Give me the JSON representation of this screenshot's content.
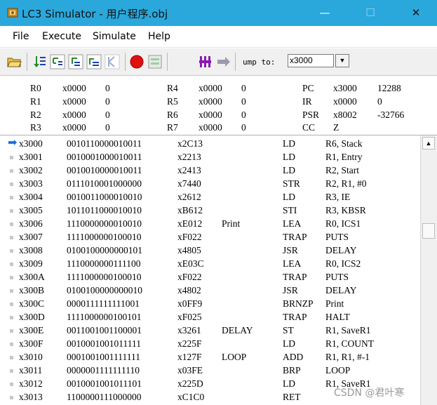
{
  "window": {
    "title": "LC3 Simulator - 用户程序.obj",
    "minimize": "—",
    "maximize": "☐",
    "close": "✕",
    "titlebar_color": "#2aa8dc"
  },
  "menu": {
    "file": "File",
    "execute": "Execute",
    "simulate": "Simulate",
    "help": "Help"
  },
  "toolbar": {
    "jump_label": "ump to:",
    "jump_value": "x3000",
    "jump_dropdown": "▼"
  },
  "registers": {
    "R0": {
      "name": "R0",
      "hex": "x0000",
      "dec": "0"
    },
    "R1": {
      "name": "R1",
      "hex": "x0000",
      "dec": "0"
    },
    "R2": {
      "name": "R2",
      "hex": "x0000",
      "dec": "0"
    },
    "R3": {
      "name": "R3",
      "hex": "x0000",
      "dec": "0"
    },
    "R4": {
      "name": "R4",
      "hex": "x0000",
      "dec": "0"
    },
    "R5": {
      "name": "R5",
      "hex": "x0000",
      "dec": "0"
    },
    "R6": {
      "name": "R6",
      "hex": "x0000",
      "dec": "0"
    },
    "R7": {
      "name": "R7",
      "hex": "x0000",
      "dec": "0"
    },
    "PC": {
      "name": "PC",
      "hex": "x3000",
      "dec": "12288"
    },
    "IR": {
      "name": "IR",
      "hex": "x0000",
      "dec": "0"
    },
    "PSR": {
      "name": "PSR",
      "hex": "x8002",
      "dec": "-32766"
    },
    "CC": {
      "name": "CC",
      "value": "Z"
    }
  },
  "code": [
    {
      "addr": "x3000",
      "bin": "0010110000010011",
      "hex": "x2C13",
      "label": "",
      "op": "LD",
      "args": "R6, Stack",
      "current": true
    },
    {
      "addr": "x3001",
      "bin": "0010001000010011",
      "hex": "x2213",
      "label": "",
      "op": "LD",
      "args": "R1, Entry"
    },
    {
      "addr": "x3002",
      "bin": "0010010000010011",
      "hex": "x2413",
      "label": "",
      "op": "LD",
      "args": "R2, Start"
    },
    {
      "addr": "x3003",
      "bin": "0111010001000000",
      "hex": "x7440",
      "label": "",
      "op": "STR",
      "args": "R2, R1, #0"
    },
    {
      "addr": "x3004",
      "bin": "0010011000010010",
      "hex": "x2612",
      "label": "",
      "op": "LD",
      "args": "R3, IE"
    },
    {
      "addr": "x3005",
      "bin": "1011011000010010",
      "hex": "xB612",
      "label": "",
      "op": "STI",
      "args": "R3, KBSR"
    },
    {
      "addr": "x3006",
      "bin": "1110000000010010",
      "hex": "xE012",
      "label": "Print",
      "op": "LEA",
      "args": "R0, ICS1"
    },
    {
      "addr": "x3007",
      "bin": "1111000000100010",
      "hex": "xF022",
      "label": "",
      "op": "TRAP",
      "args": "PUTS"
    },
    {
      "addr": "x3008",
      "bin": "0100100000000101",
      "hex": "x4805",
      "label": "",
      "op": "JSR",
      "args": "DELAY"
    },
    {
      "addr": "x3009",
      "bin": "1110000000111100",
      "hex": "xE03C",
      "label": "",
      "op": "LEA",
      "args": "R0, ICS2"
    },
    {
      "addr": "x300A",
      "bin": "1111000000100010",
      "hex": "xF022",
      "label": "",
      "op": "TRAP",
      "args": "PUTS"
    },
    {
      "addr": "x300B",
      "bin": "0100100000000010",
      "hex": "x4802",
      "label": "",
      "op": "JSR",
      "args": "DELAY"
    },
    {
      "addr": "x300C",
      "bin": "0000111111111001",
      "hex": "x0FF9",
      "label": "",
      "op": "BRNZP",
      "args": "Print"
    },
    {
      "addr": "x300D",
      "bin": "1111000000100101",
      "hex": "xF025",
      "label": "",
      "op": "TRAP",
      "args": "HALT"
    },
    {
      "addr": "x300E",
      "bin": "0011001001100001",
      "hex": "x3261",
      "label": "DELAY",
      "op": "ST",
      "args": "R1, SaveR1"
    },
    {
      "addr": "x300F",
      "bin": "0010001001011111",
      "hex": "x225F",
      "label": "",
      "op": "LD",
      "args": "R1, COUNT"
    },
    {
      "addr": "x3010",
      "bin": "0001001001111111",
      "hex": "x127F",
      "label": "LOOP",
      "op": "ADD",
      "args": "R1, R1, #-1"
    },
    {
      "addr": "x3011",
      "bin": "0000001111111110",
      "hex": "x03FE",
      "label": "",
      "op": "BRP",
      "args": "LOOP"
    },
    {
      "addr": "x3012",
      "bin": "0010001001011101",
      "hex": "x225D",
      "label": "",
      "op": "LD",
      "args": "R1, SaveR1"
    },
    {
      "addr": "x3013",
      "bin": "1100000111000000",
      "hex": "xC1C0",
      "label": "",
      "op": "RET",
      "args": ""
    }
  ],
  "watermark": "CSDN @君叶寒"
}
